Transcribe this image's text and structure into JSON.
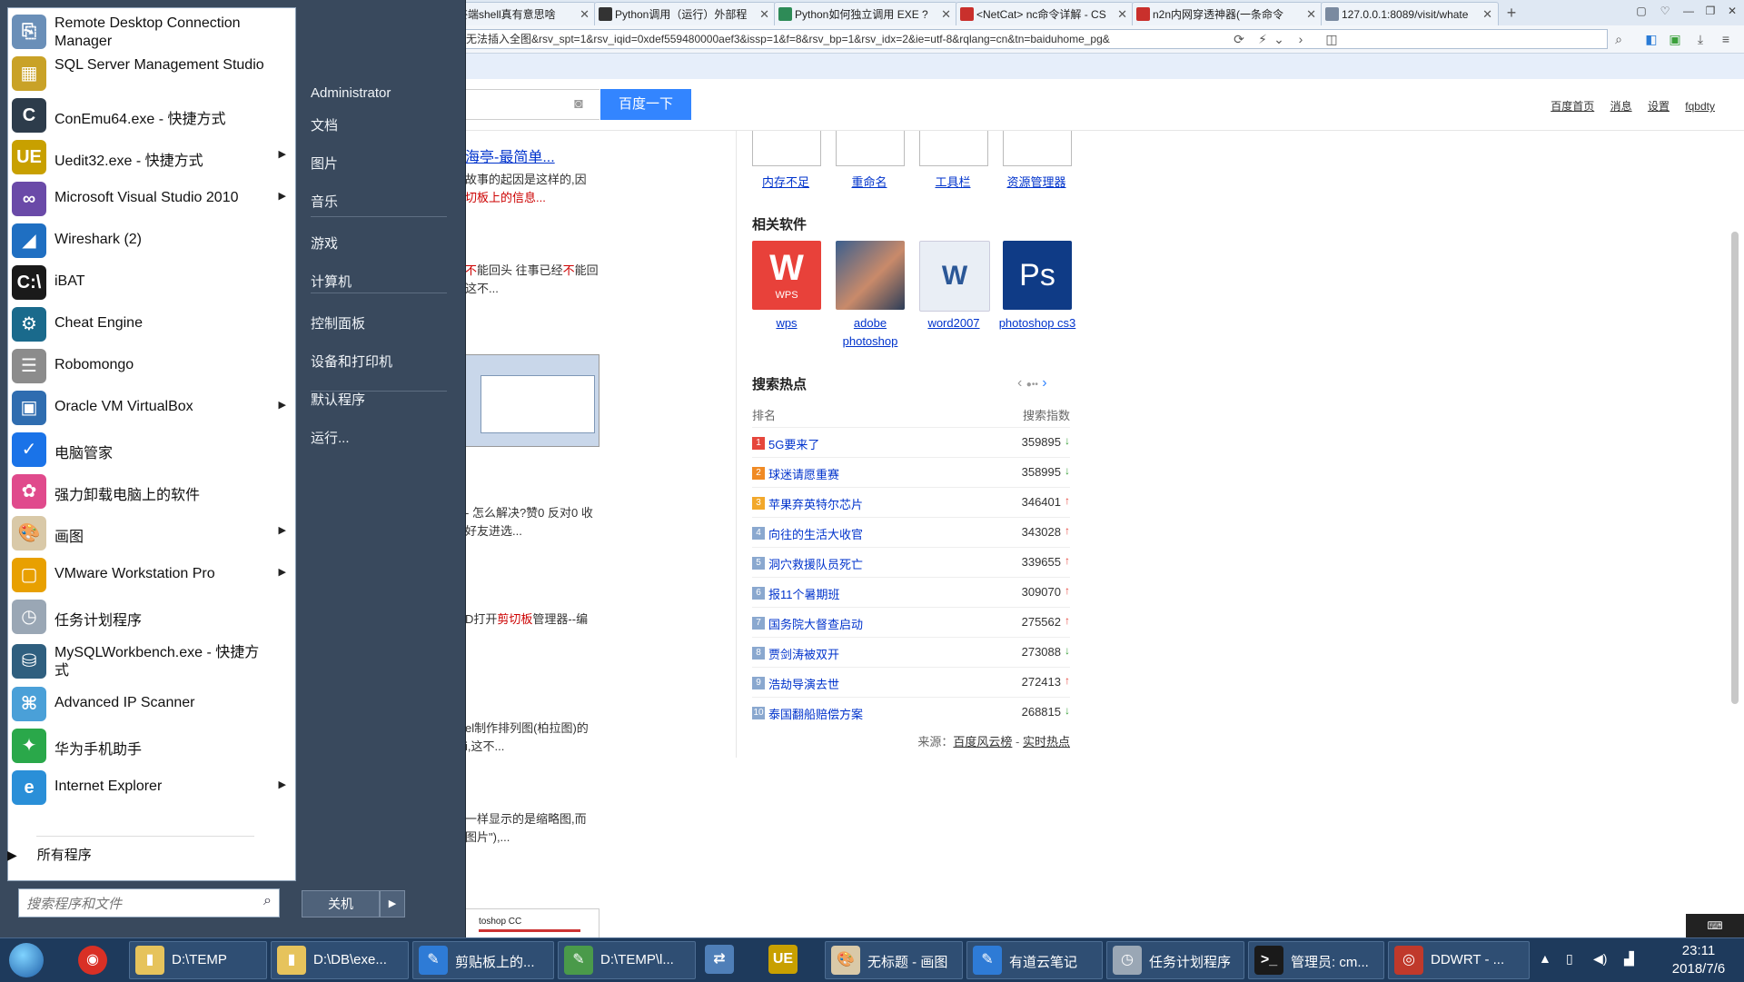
{
  "browser": {
    "tabs": [
      {
        "title": "...终端shell真有意思啥",
        "favicon": "page-icon",
        "color": "#7a8aa0"
      },
      {
        "title": "Python调用（运行）外部程",
        "favicon": "github-icon",
        "color": "#333333"
      },
      {
        "title": "Python如何独立调用 EXE ?",
        "favicon": "sf-icon",
        "color": "#2e8b57"
      },
      {
        "title": "<NetCat> nc命令详解 - CS",
        "favicon": "csdn-icon",
        "color": "#c9302c"
      },
      {
        "title": "n2n内网穿透神器(一条命令",
        "favicon": "csdn-icon",
        "color": "#c9302c"
      },
      {
        "title": "127.0.0.1:8089/visit/whate",
        "favicon": "page-icon",
        "color": "#7a8aa0"
      }
    ],
    "new_tab": "+",
    "address": "无法插入全图&rsv_spt=1&rsv_iqid=0xdef559480000aef3&issp=1&f=8&rsv_bp=1&rsv_idx=2&ie=utf-8&rqlang=cn&tn=baiduhome_pg&"
  },
  "baidu": {
    "search_button": "百度一下",
    "links": [
      "百度首页",
      "消息",
      "设置",
      "fqbdty"
    ],
    "results": [
      {
        "title_fragment": "海亭-最简单...",
        "line1": "故事的起因是这样的,因",
        "line2_em": "切板上的信息..."
      },
      {
        "line1_a": "不",
        "line1_b": "能回头 往事已经",
        "line1_c": "不",
        "line1_d": "能回",
        "line2": "这不..."
      },
      {
        "line1": "- 怎么解决?赞0 反对0 收",
        "line2": "好友进选..."
      },
      {
        "line1_a": "D打开",
        "line1_em": "剪切板",
        "line1_b": "管理器--编"
      },
      {
        "line1": "el制作排列图(柏拉图)的",
        "line2": "i,这不..."
      },
      {
        "line1": "一样显示的是缩略图,而",
        "line2": "图片\"),..."
      }
    ],
    "thumb_bottom_label": "toshop CC",
    "image_captions": [
      "内存不足",
      "重命名",
      "工具栏",
      "资源管理器"
    ],
    "related_title": "相关软件",
    "software": [
      {
        "name": "wps",
        "icon": "wps-icon",
        "glyph": "W",
        "color": "#e8413a"
      },
      {
        "name": "adobe photoshop",
        "icon": "photoshop-portrait-icon",
        "glyph": "",
        "color": "#5b7da8"
      },
      {
        "name": "word2007",
        "icon": "word-doc-icon",
        "glyph": "W",
        "color": "#e9eef5"
      },
      {
        "name": "photoshop cs3",
        "icon": "ps-icon",
        "glyph": "Ps",
        "color": "#0f3b86"
      }
    ],
    "hot_title": "搜索热点",
    "hot_head_rank": "排名",
    "hot_head_index": "搜索指数",
    "hot": [
      {
        "rank": "1",
        "title": "5G要来了",
        "value": "359895",
        "trend": "down"
      },
      {
        "rank": "2",
        "title": "球迷请愿重赛",
        "value": "358995",
        "trend": "down"
      },
      {
        "rank": "3",
        "title": "苹果弃英特尔芯片",
        "value": "346401",
        "trend": "up"
      },
      {
        "rank": "4",
        "title": "向往的生活大收官",
        "value": "343028",
        "trend": "up"
      },
      {
        "rank": "5",
        "title": "洞穴救援队员死亡",
        "value": "339655",
        "trend": "up"
      },
      {
        "rank": "6",
        "title": "报11个暑期班",
        "value": "309070",
        "trend": "up"
      },
      {
        "rank": "7",
        "title": "国务院大督查启动",
        "value": "275562",
        "trend": "up"
      },
      {
        "rank": "8",
        "title": "贾剑涛被双开",
        "value": "273088",
        "trend": "down"
      },
      {
        "rank": "9",
        "title": "浩劫导演去世",
        "value": "272413",
        "trend": "up"
      },
      {
        "rank": "10",
        "title": "泰国翻船赔偿方案",
        "value": "268815",
        "trend": "down"
      }
    ],
    "source_prefix": "来源：",
    "source_link1": "百度风云榜",
    "source_sep": " - ",
    "source_link2": "实时热点"
  },
  "startmenu": {
    "programs": [
      {
        "label": "Remote Desktop Connection Manager",
        "icon": "remote-desktop-icon",
        "glyph": "⎘",
        "color": "#6a8fb8",
        "arrow": false,
        "two_line": true
      },
      {
        "label": "SQL Server Management Studio",
        "icon": "sql-server-icon",
        "glyph": "▦",
        "color": "#c9a227",
        "arrow": false,
        "two_line": true
      },
      {
        "label": "ConEmu64.exe - 快捷方式",
        "icon": "conemu-icon",
        "glyph": "C",
        "color": "#2d3c4b",
        "arrow": false,
        "two_line": false
      },
      {
        "label": "Uedit32.exe - 快捷方式",
        "icon": "ultraedit-icon",
        "glyph": "UE",
        "color": "#c8a000",
        "arrow": true,
        "two_line": false
      },
      {
        "label": "Microsoft Visual Studio 2010",
        "icon": "visual-studio-icon",
        "glyph": "∞",
        "color": "#6a4aa8",
        "arrow": true,
        "two_line": false
      },
      {
        "label": "Wireshark (2)",
        "icon": "wireshark-icon",
        "glyph": "◢",
        "color": "#1f6fc2",
        "arrow": false,
        "two_line": false
      },
      {
        "label": "iBAT",
        "icon": "ibat-console-icon",
        "glyph": "C:\\",
        "color": "#1a1a1a",
        "arrow": false,
        "two_line": false
      },
      {
        "label": "Cheat Engine",
        "icon": "cheat-engine-icon",
        "glyph": "⚙",
        "color": "#1a6a8c",
        "arrow": false,
        "two_line": false
      },
      {
        "label": "Robomongo",
        "icon": "robomongo-icon",
        "glyph": "☰",
        "color": "#8c8c8c",
        "arrow": false,
        "two_line": false
      },
      {
        "label": "Oracle VM VirtualBox",
        "icon": "virtualbox-icon",
        "glyph": "▣",
        "color": "#2f6db0",
        "arrow": true,
        "two_line": false
      },
      {
        "label": "电脑管家",
        "icon": "pc-manager-shield-icon",
        "glyph": "✓",
        "color": "#1a73e8",
        "arrow": false,
        "two_line": false
      },
      {
        "label": "强力卸载电脑上的软件",
        "icon": "uninstaller-icon",
        "glyph": "✿",
        "color": "#e04a8c",
        "arrow": false,
        "two_line": false
      },
      {
        "label": "画图",
        "icon": "paint-palette-icon",
        "glyph": "🎨",
        "color": "#d9c9a8",
        "arrow": true,
        "two_line": false
      },
      {
        "label": "VMware Workstation Pro",
        "icon": "vmware-icon",
        "glyph": "▢",
        "color": "#e8a000",
        "arrow": true,
        "two_line": false
      },
      {
        "label": "任务计划程序",
        "icon": "task-scheduler-clock-icon",
        "glyph": "◷",
        "color": "#9aa7b5",
        "arrow": false,
        "two_line": false
      },
      {
        "label": "MySQLWorkbench.exe - 快捷方式",
        "icon": "mysql-workbench-icon",
        "glyph": "⛁",
        "color": "#2f5f7f",
        "arrow": false,
        "two_line": true
      },
      {
        "label": "Advanced IP Scanner",
        "icon": "ip-scanner-icon",
        "glyph": "⌘",
        "color": "#4aa0d8",
        "arrow": false,
        "two_line": false
      },
      {
        "label": "华为手机助手",
        "icon": "huawei-assistant-icon",
        "glyph": "✦",
        "color": "#2aa84a",
        "arrow": false,
        "two_line": false
      },
      {
        "label": "Internet Explorer",
        "icon": "internet-explorer-icon",
        "glyph": "e",
        "color": "#2a8fd8",
        "arrow": true,
        "two_line": false
      }
    ],
    "all_programs": "所有程序",
    "search_placeholder": "搜索程序和文件",
    "places": [
      "Administrator",
      "文档",
      "图片",
      "音乐",
      "游戏",
      "计算机",
      "控制面板",
      "设备和打印机",
      "默认程序",
      "运行..."
    ],
    "shutdown": "关机"
  },
  "taskbar": {
    "pinned": [
      {
        "icon": "chrome-icon",
        "glyph": "◉",
        "color": "#d93025"
      }
    ],
    "buttons": [
      {
        "label": "D:\\TEMP",
        "icon": "folder-icon",
        "glyph": "▮",
        "color": "#e6c35c"
      },
      {
        "label": "D:\\DB\\exe...",
        "icon": "folder-icon",
        "glyph": "▮",
        "color": "#e6c35c"
      },
      {
        "label": "剪贴板上的...",
        "icon": "feather-browser-icon",
        "glyph": "✎",
        "color": "#2e7bd6"
      },
      {
        "label": "D:\\TEMP\\l...",
        "icon": "notepad-excel-icon",
        "glyph": "✎",
        "color": "#4a9a4a"
      },
      {
        "label": "",
        "icon": "network-icon",
        "glyph": "⇄",
        "color": "#4f7fb8"
      },
      {
        "label": "",
        "icon": "ultraedit-taskbar-icon",
        "glyph": "UE",
        "color": "#c8a000"
      },
      {
        "label": "无标题 - 画图",
        "icon": "paint-taskbar-icon",
        "glyph": "🎨",
        "color": "#d9c9a8"
      },
      {
        "label": "有道云笔记",
        "icon": "youdao-note-icon",
        "glyph": "✎",
        "color": "#2e7bd6"
      },
      {
        "label": "任务计划程序",
        "icon": "task-scheduler-taskbar-icon",
        "glyph": "◷",
        "color": "#9aa7b5"
      },
      {
        "label": "管理员: cm...",
        "icon": "cmd-icon",
        "glyph": ">_",
        "color": "#1a1a1a"
      },
      {
        "label": "DDWRT - ...",
        "icon": "ddwrt-icon",
        "glyph": "◎",
        "color": "#c0392b"
      }
    ],
    "clock_time": "23:11",
    "clock_date": "2018/7/6",
    "keyboard_indicator": "⌨"
  }
}
